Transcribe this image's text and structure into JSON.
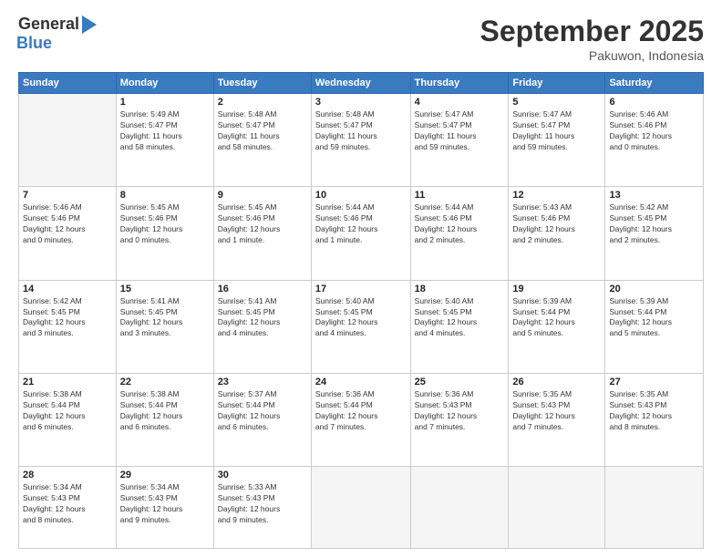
{
  "logo": {
    "general": "General",
    "blue": "Blue"
  },
  "title": {
    "month": "September 2025",
    "location": "Pakuwon, Indonesia"
  },
  "headers": [
    "Sunday",
    "Monday",
    "Tuesday",
    "Wednesday",
    "Thursday",
    "Friday",
    "Saturday"
  ],
  "weeks": [
    [
      {
        "num": "",
        "info": ""
      },
      {
        "num": "1",
        "info": "Sunrise: 5:49 AM\nSunset: 5:47 PM\nDaylight: 11 hours\nand 58 minutes."
      },
      {
        "num": "2",
        "info": "Sunrise: 5:48 AM\nSunset: 5:47 PM\nDaylight: 11 hours\nand 58 minutes."
      },
      {
        "num": "3",
        "info": "Sunrise: 5:48 AM\nSunset: 5:47 PM\nDaylight: 11 hours\nand 59 minutes."
      },
      {
        "num": "4",
        "info": "Sunrise: 5:47 AM\nSunset: 5:47 PM\nDaylight: 11 hours\nand 59 minutes."
      },
      {
        "num": "5",
        "info": "Sunrise: 5:47 AM\nSunset: 5:47 PM\nDaylight: 11 hours\nand 59 minutes."
      },
      {
        "num": "6",
        "info": "Sunrise: 5:46 AM\nSunset: 5:46 PM\nDaylight: 12 hours\nand 0 minutes."
      }
    ],
    [
      {
        "num": "7",
        "info": "Sunrise: 5:46 AM\nSunset: 5:46 PM\nDaylight: 12 hours\nand 0 minutes."
      },
      {
        "num": "8",
        "info": "Sunrise: 5:45 AM\nSunset: 5:46 PM\nDaylight: 12 hours\nand 0 minutes."
      },
      {
        "num": "9",
        "info": "Sunrise: 5:45 AM\nSunset: 5:46 PM\nDaylight: 12 hours\nand 1 minute."
      },
      {
        "num": "10",
        "info": "Sunrise: 5:44 AM\nSunset: 5:46 PM\nDaylight: 12 hours\nand 1 minute."
      },
      {
        "num": "11",
        "info": "Sunrise: 5:44 AM\nSunset: 5:46 PM\nDaylight: 12 hours\nand 2 minutes."
      },
      {
        "num": "12",
        "info": "Sunrise: 5:43 AM\nSunset: 5:46 PM\nDaylight: 12 hours\nand 2 minutes."
      },
      {
        "num": "13",
        "info": "Sunrise: 5:42 AM\nSunset: 5:45 PM\nDaylight: 12 hours\nand 2 minutes."
      }
    ],
    [
      {
        "num": "14",
        "info": "Sunrise: 5:42 AM\nSunset: 5:45 PM\nDaylight: 12 hours\nand 3 minutes."
      },
      {
        "num": "15",
        "info": "Sunrise: 5:41 AM\nSunset: 5:45 PM\nDaylight: 12 hours\nand 3 minutes."
      },
      {
        "num": "16",
        "info": "Sunrise: 5:41 AM\nSunset: 5:45 PM\nDaylight: 12 hours\nand 4 minutes."
      },
      {
        "num": "17",
        "info": "Sunrise: 5:40 AM\nSunset: 5:45 PM\nDaylight: 12 hours\nand 4 minutes."
      },
      {
        "num": "18",
        "info": "Sunrise: 5:40 AM\nSunset: 5:45 PM\nDaylight: 12 hours\nand 4 minutes."
      },
      {
        "num": "19",
        "info": "Sunrise: 5:39 AM\nSunset: 5:44 PM\nDaylight: 12 hours\nand 5 minutes."
      },
      {
        "num": "20",
        "info": "Sunrise: 5:39 AM\nSunset: 5:44 PM\nDaylight: 12 hours\nand 5 minutes."
      }
    ],
    [
      {
        "num": "21",
        "info": "Sunrise: 5:38 AM\nSunset: 5:44 PM\nDaylight: 12 hours\nand 6 minutes."
      },
      {
        "num": "22",
        "info": "Sunrise: 5:38 AM\nSunset: 5:44 PM\nDaylight: 12 hours\nand 6 minutes."
      },
      {
        "num": "23",
        "info": "Sunrise: 5:37 AM\nSunset: 5:44 PM\nDaylight: 12 hours\nand 6 minutes."
      },
      {
        "num": "24",
        "info": "Sunrise: 5:36 AM\nSunset: 5:44 PM\nDaylight: 12 hours\nand 7 minutes."
      },
      {
        "num": "25",
        "info": "Sunrise: 5:36 AM\nSunset: 5:43 PM\nDaylight: 12 hours\nand 7 minutes."
      },
      {
        "num": "26",
        "info": "Sunrise: 5:35 AM\nSunset: 5:43 PM\nDaylight: 12 hours\nand 7 minutes."
      },
      {
        "num": "27",
        "info": "Sunrise: 5:35 AM\nSunset: 5:43 PM\nDaylight: 12 hours\nand 8 minutes."
      }
    ],
    [
      {
        "num": "28",
        "info": "Sunrise: 5:34 AM\nSunset: 5:43 PM\nDaylight: 12 hours\nand 8 minutes."
      },
      {
        "num": "29",
        "info": "Sunrise: 5:34 AM\nSunset: 5:43 PM\nDaylight: 12 hours\nand 9 minutes."
      },
      {
        "num": "30",
        "info": "Sunrise: 5:33 AM\nSunset: 5:43 PM\nDaylight: 12 hours\nand 9 minutes."
      },
      {
        "num": "",
        "info": ""
      },
      {
        "num": "",
        "info": ""
      },
      {
        "num": "",
        "info": ""
      },
      {
        "num": "",
        "info": ""
      }
    ]
  ]
}
